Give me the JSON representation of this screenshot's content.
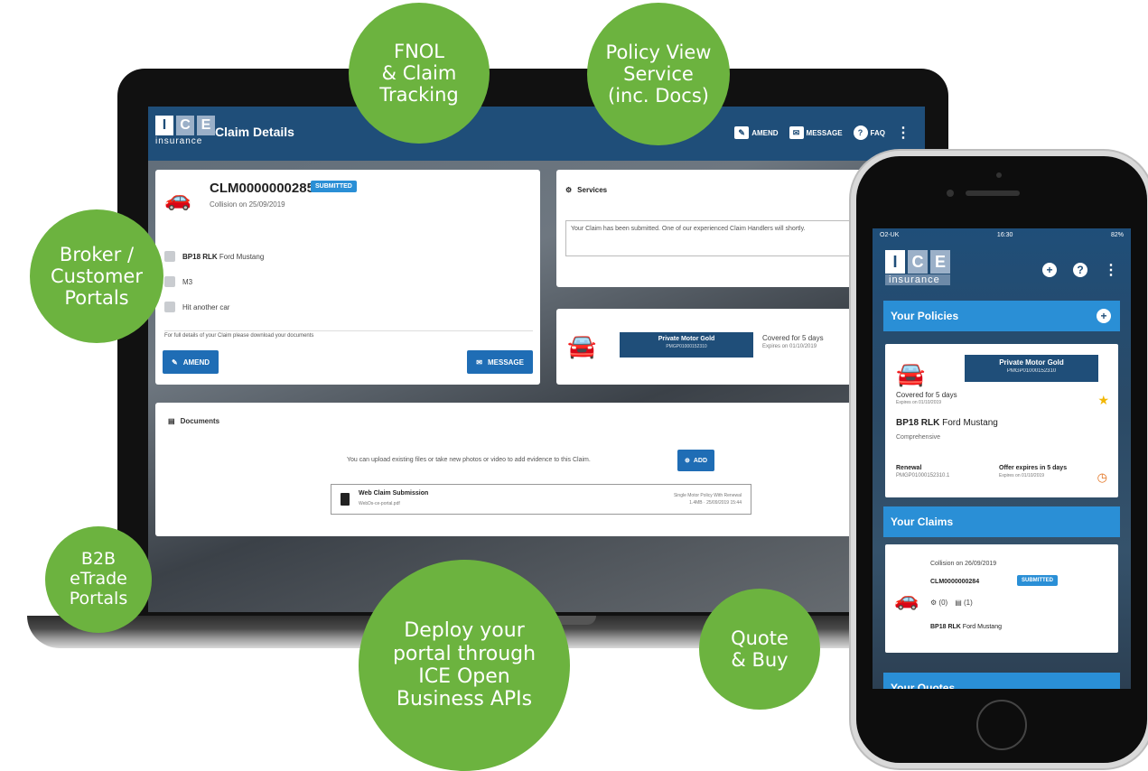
{
  "laptop": {
    "header": {
      "logo_letters": [
        "I",
        "C",
        "E"
      ],
      "logo_word": "insurance",
      "title": "Claim Details",
      "actions": [
        {
          "label": "AMEND",
          "icon": "pencil-icon"
        },
        {
          "label": "MESSAGE",
          "icon": "envelope-icon"
        },
        {
          "label": "FAQ",
          "icon": "question-icon"
        }
      ]
    },
    "claim": {
      "number": "CLM0000000285",
      "status": "SUBMITTED",
      "subtitle": "Collision on 25/09/2019",
      "reg": "BP18 RLK",
      "vehicle": "Ford Mustang",
      "location": "M3",
      "description": "Hit another car",
      "note": "For full details of your Claim please download your documents",
      "amend_label": "AMEND",
      "message_label": "MESSAGE"
    },
    "services": {
      "title": "Services",
      "message": "Your Claim has been submitted. One of our experienced Claim Handlers will shortly."
    },
    "policy": {
      "name": "Private Motor Gold",
      "number": "PMGP01000152310",
      "cover": "Covered for 5 days",
      "expires": "Expires on 01/10/2019"
    },
    "documents": {
      "title": "Documents",
      "prompt": "You can upload existing files or take new photos or video to add evidence to this Claim.",
      "add_label": "ADD",
      "file_title": "Web Claim Submission",
      "file_name": "WebDs-ce-portal.pdf",
      "file_meta_1": "Single Motor Policy With Renewal",
      "file_meta_2": "1.4MB · 25/09/2019 15:44"
    }
  },
  "phone": {
    "status": {
      "carrier": "O2-UK",
      "time": "16:30",
      "battery": "82%"
    },
    "logo_letters": [
      "I",
      "C",
      "E"
    ],
    "logo_word": "insurance",
    "sections": {
      "policies": "Your Policies",
      "claims": "Your Claims",
      "quotes": "Your Quotes"
    },
    "policy": {
      "name": "Private Motor Gold",
      "number": "PMGP01000152310",
      "cover": "Covered for 5 days",
      "expires": "Expires on 01/10/2019",
      "reg": "BP18 RLK",
      "vehicle": "Ford Mustang",
      "cover_type": "Comprehensive",
      "renewal_label": "Renewal",
      "renewal_ref": "PMGP01000152310.1",
      "offer": "Offer expires in 5 days",
      "offer_sub": "Expires on 01/10/2019"
    },
    "claim": {
      "subtitle": "Collision on 26/09/2019",
      "number": "CLM0000000284",
      "status": "SUBMITTED",
      "services_count": "0",
      "docs_count": "1",
      "reg": "BP18 RLK",
      "vehicle": "Ford Mustang"
    }
  },
  "bubbles": {
    "fnol": "FNOL\n& Claim\nTracking",
    "policy_view": "Policy View\nService\n(inc. Docs)",
    "broker": "Broker /\nCustomer\nPortals",
    "b2b": "B2B\neTrade\nPortals",
    "deploy": "Deploy your\nportal through\nICE Open\nBusiness APIs",
    "quote": "Quote\n& Buy"
  },
  "colors": {
    "brand_navy": "#1f4e79",
    "accent_blue": "#2a8fd6",
    "bubble_green": "#6cb33f",
    "star_yellow": "#f2b705",
    "clock_orange": "#e2711d"
  }
}
